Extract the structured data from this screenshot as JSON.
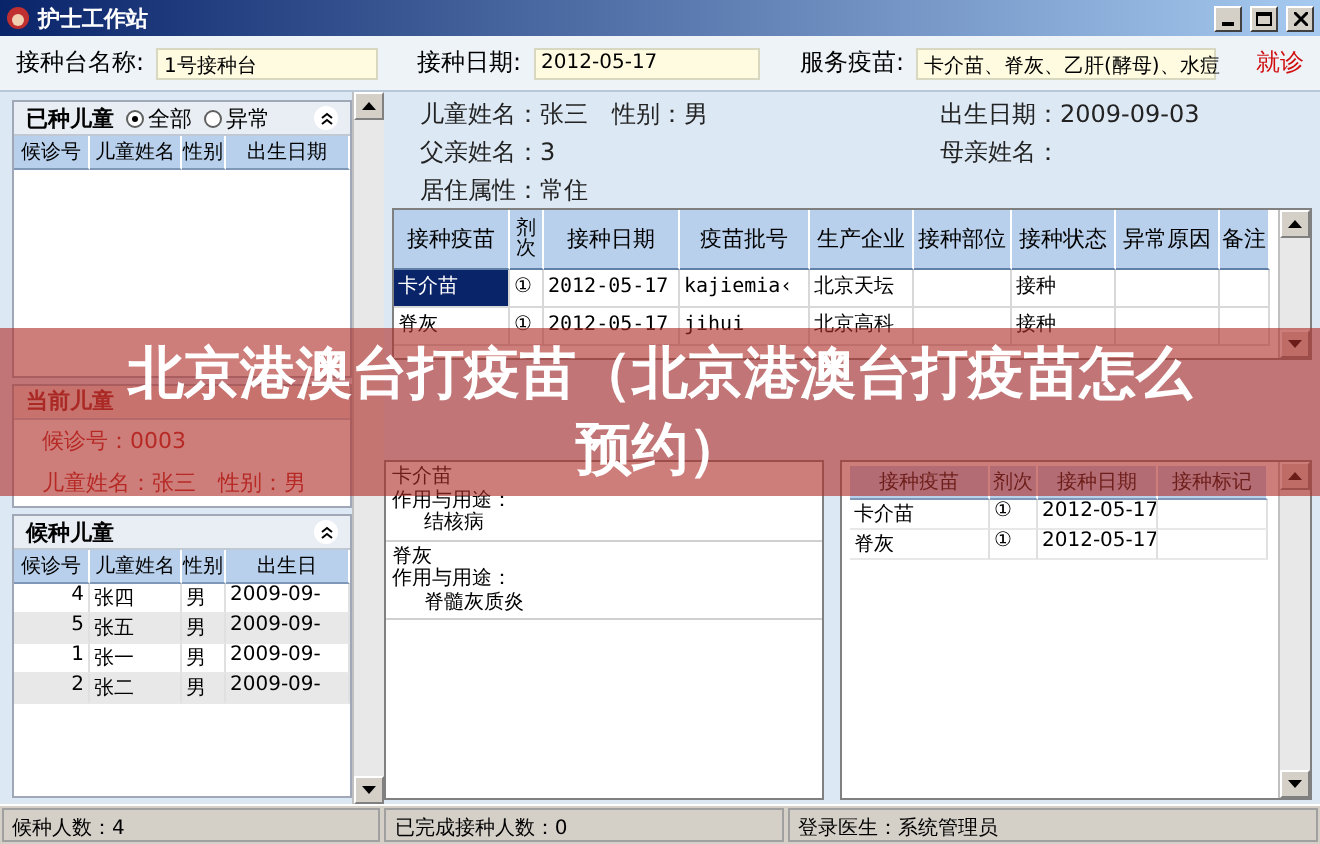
{
  "window": {
    "title": "护士工作站"
  },
  "toolbar": {
    "fields": [
      {
        "label": "接种台名称:",
        "value": "1号接种台"
      },
      {
        "label": "接种日期:",
        "value": "2012-05-17"
      },
      {
        "label": "服务疫苗:",
        "value": "卡介苗、脊灰、乙肝(酵母)、水痘"
      }
    ],
    "notice": "就诊"
  },
  "vaccinated_panel": {
    "title": "已种儿童",
    "filters": [
      {
        "label": "全部",
        "selected": true
      },
      {
        "label": "异常",
        "selected": false
      }
    ],
    "columns": [
      "候诊号",
      "儿童姓名",
      "性别",
      "出生日期"
    ]
  },
  "current_panel": {
    "title": "当前儿童",
    "lines": [
      "候诊号：0003",
      "儿童姓名：张三　性别：男"
    ]
  },
  "waiting_panel": {
    "title": "候种儿童",
    "columns": [
      "候诊号",
      "儿童姓名",
      "性别",
      "出生日"
    ],
    "rows": [
      {
        "cells": [
          "4",
          "张四",
          "男",
          "2009-09-"
        ],
        "selected": false
      },
      {
        "cells": [
          "5",
          "张五",
          "男",
          "2009-09-"
        ],
        "selected": true
      },
      {
        "cells": [
          "1",
          "张一",
          "男",
          "2009-09-"
        ],
        "selected": false
      },
      {
        "cells": [
          "2",
          "张二",
          "男",
          "2009-09-"
        ],
        "selected": true
      }
    ]
  },
  "child_info": [
    {
      "label": "儿童姓名：",
      "value": "张三",
      "extra_label": "性别：",
      "extra_value": "男"
    },
    {
      "label": "出生日期：",
      "value": "2009-09-03"
    },
    {
      "label": "父亲姓名：",
      "value": "3"
    },
    {
      "label": "母亲姓名："
    },
    {
      "label": "居住属性：",
      "value": "常住"
    }
  ],
  "vaccine_table": {
    "columns": [
      "接种疫苗",
      "剂次",
      "接种日期",
      "疫苗批号",
      "生产企业",
      "接种部位",
      "接种状态",
      "异常原因",
      "备注"
    ],
    "rows": [
      {
        "cells": [
          "卡介苗",
          "①",
          "2012-05-17",
          "kajiemia‹",
          "北京天坛",
          "",
          "接种",
          "",
          ""
        ],
        "selected": true
      },
      {
        "cells": [
          "脊灰",
          "①",
          "2012-05-17",
          "jihui",
          "北京高科",
          "",
          "接种",
          "",
          ""
        ],
        "selected": false
      }
    ]
  },
  "vaccine_notes": [
    {
      "name": "卡介苗",
      "usage_label": "作用与用途：",
      "usage": "结核病"
    },
    {
      "name": "脊灰",
      "usage_label": "作用与用途：",
      "usage": "脊髓灰质炎"
    }
  ],
  "history_table": {
    "columns": [
      "接种疫苗",
      "剂次",
      "接种日期",
      "接种标记"
    ],
    "rows": [
      [
        "卡介苗",
        "①",
        "2012-05-17",
        ""
      ],
      [
        "脊灰",
        "①",
        "2012-05-17",
        ""
      ]
    ]
  },
  "status_bar": [
    "候种人数：4",
    "已完成接种人数：0",
    "登录医生：系统管理员"
  ],
  "banner": "北京港澳台打疫苗（北京港澳台打疫苗怎么预约）"
}
